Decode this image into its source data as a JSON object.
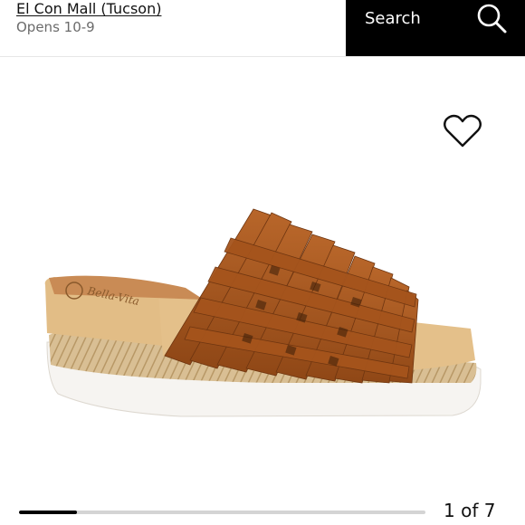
{
  "header": {
    "store_name": "El Con Mall (Tucson)",
    "store_hours": "Opens 10-9",
    "search_label": "Search",
    "search_icon": "magnifier-icon"
  },
  "product": {
    "favorite_icon": "heart-outline-icon",
    "sole_brand_text": "Bella-Vita"
  },
  "carousel": {
    "counter": "1 of 7",
    "current": 1,
    "total": 7
  },
  "colors": {
    "header_bg": "#000000",
    "leather": "#a8591f",
    "footbed": "#e2bd86"
  }
}
